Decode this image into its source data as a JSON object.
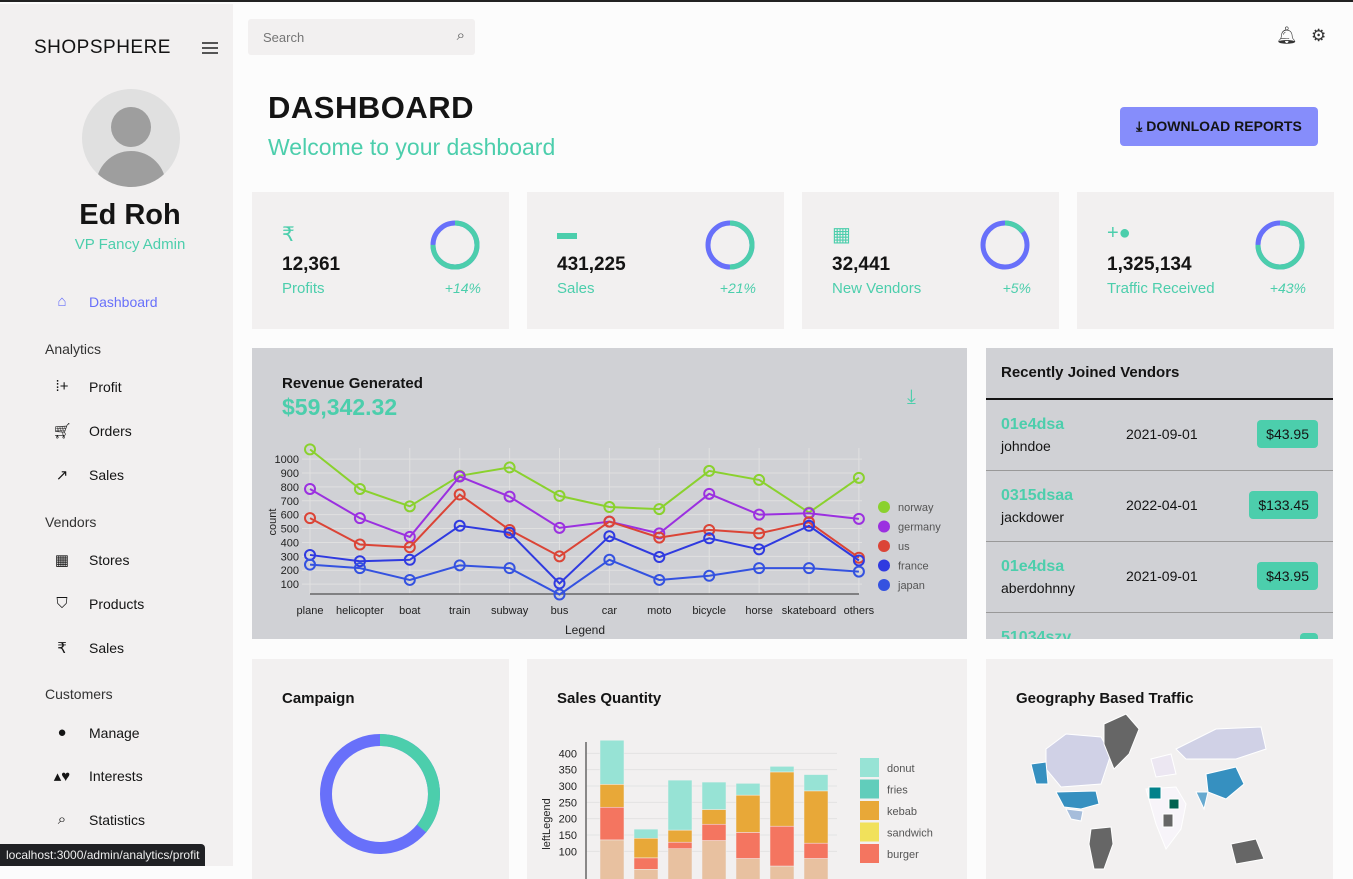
{
  "sidebar": {
    "brand": "SHOPSPHERE",
    "user": {
      "name": "Ed Roh",
      "role": "VP Fancy Admin"
    },
    "dashboard": "Dashboard",
    "sections": [
      {
        "title": "Analytics",
        "items": [
          {
            "label": "Profit",
            "icon": "profit-chart-icon"
          },
          {
            "label": "Orders",
            "icon": "cart-icon"
          },
          {
            "label": "Sales",
            "icon": "trending-up-icon"
          }
        ]
      },
      {
        "title": "Vendors",
        "items": [
          {
            "label": "Stores",
            "icon": "store-icon"
          },
          {
            "label": "Products",
            "icon": "basket-icon"
          },
          {
            "label": "Sales",
            "icon": "rupee-icon"
          }
        ]
      },
      {
        "title": "Customers",
        "items": [
          {
            "label": "Manage",
            "icon": "person-icon"
          },
          {
            "label": "Interests",
            "icon": "interests-icon"
          },
          {
            "label": "Statistics",
            "icon": "query-stats-icon"
          }
        ]
      }
    ],
    "status_url": "localhost:3000/admin/analytics/profit"
  },
  "topbar": {
    "search_placeholder": "Search"
  },
  "header": {
    "title": "DASHBOARD",
    "subtitle": "Welcome to your dashboard",
    "download": "DOWNLOAD REPORTS"
  },
  "colors": {
    "accent": "#4cceac",
    "blue": "#6870fa",
    "button": "#868dfb"
  },
  "stats": [
    {
      "value": "12,361",
      "label": "Profits",
      "increase": "+14%",
      "progress": 0.75,
      "icon": "rupee-icon"
    },
    {
      "value": "431,225",
      "label": "Sales",
      "increase": "+21%",
      "progress": 0.5,
      "icon": "point-of-sale-icon"
    },
    {
      "value": "32,441",
      "label": "New Vendors",
      "increase": "+5%",
      "progress": 0.15,
      "icon": "store-icon"
    },
    {
      "value": "1,325,134",
      "label": "Traffic Received",
      "increase": "+43%",
      "progress": 0.75,
      "icon": "person-add-icon"
    }
  ],
  "revenue": {
    "title": "Revenue Generated",
    "amount": "$59,342.32"
  },
  "vendors": {
    "title": "Recently Joined Vendors",
    "rows": [
      {
        "id": "01e4dsa",
        "user": "johndoe",
        "date": "2021-09-01",
        "cost": "$43.95"
      },
      {
        "id": "0315dsaa",
        "user": "jackdower",
        "date": "2022-04-01",
        "cost": "$133.45"
      },
      {
        "id": "01e4dsa",
        "user": "aberdohnny",
        "date": "2021-09-01",
        "cost": "$43.95"
      },
      {
        "id": "51034szv",
        "user": "",
        "date": "",
        "cost": ""
      }
    ]
  },
  "campaign": {
    "title": "Campaign",
    "progress": 0.36
  },
  "geo": {
    "title": "Geography Based Traffic"
  },
  "chart_data": [
    {
      "type": "line",
      "xlabel": "Legend",
      "ylabel": "count",
      "ylim": [
        0,
        1050
      ],
      "yticks": [
        100,
        200,
        300,
        400,
        500,
        600,
        700,
        800,
        900,
        1000
      ],
      "categories": [
        "plane",
        "helicopter",
        "boat",
        "train",
        "subway",
        "bus",
        "car",
        "moto",
        "bicycle",
        "horse",
        "skateboard",
        "others"
      ],
      "legend": "right",
      "series": [
        {
          "name": "norway",
          "color": "#8ad12e",
          "values": [
            1070,
            785,
            660,
            880,
            940,
            735,
            655,
            640,
            915,
            850,
            615,
            865
          ]
        },
        {
          "name": "germany",
          "color": "#9b30e0",
          "values": [
            785,
            575,
            440,
            875,
            730,
            505,
            550,
            465,
            750,
            600,
            610,
            570
          ]
        },
        {
          "name": "us",
          "color": "#db4436",
          "values": [
            575,
            385,
            365,
            745,
            490,
            300,
            550,
            435,
            490,
            465,
            545,
            290
          ]
        },
        {
          "name": "france",
          "color": "#2f3ae0",
          "values": [
            310,
            265,
            275,
            520,
            470,
            105,
            445,
            295,
            430,
            350,
            520,
            270
          ]
        },
        {
          "name": "japan",
          "color": "#3452e0",
          "values": [
            240,
            215,
            130,
            235,
            215,
            25,
            275,
            130,
            160,
            215,
            215,
            190
          ]
        }
      ]
    },
    {
      "type": "bar",
      "stacked": true,
      "ylabel": "leftLegend",
      "yticks": [
        100,
        150,
        200,
        250,
        300,
        350,
        400
      ],
      "legend": "right",
      "series": [
        {
          "name": "",
          "color": "#e8c1a0",
          "values": [
            135,
            45,
            108,
            133,
            78,
            55,
            78
          ]
        },
        {
          "name": "burger",
          "color": "#f47560",
          "values": [
            100,
            35,
            20,
            50,
            80,
            122,
            47
          ]
        },
        {
          "name": "sandwich",
          "color": "#f1e15b",
          "values": [
            0,
            0,
            0,
            0,
            0,
            0,
            0
          ]
        },
        {
          "name": "kebab",
          "color": "#e8a838",
          "values": [
            70,
            60,
            37,
            45,
            114,
            166,
            160
          ]
        },
        {
          "name": "fries",
          "color": "#61cdbb",
          "values": [
            0,
            0,
            0,
            0,
            0,
            0,
            0
          ]
        },
        {
          "name": "donut",
          "color": "#97e3d5",
          "values": [
            135,
            28,
            153,
            84,
            36,
            17,
            50
          ]
        }
      ],
      "legend_items": [
        {
          "name": "donut",
          "color": "#97e3d5"
        },
        {
          "name": "fries",
          "color": "#61cdbb"
        },
        {
          "name": "kebab",
          "color": "#e8a838"
        },
        {
          "name": "sandwich",
          "color": "#f1e15b"
        },
        {
          "name": "burger",
          "color": "#f47560"
        }
      ]
    }
  ]
}
